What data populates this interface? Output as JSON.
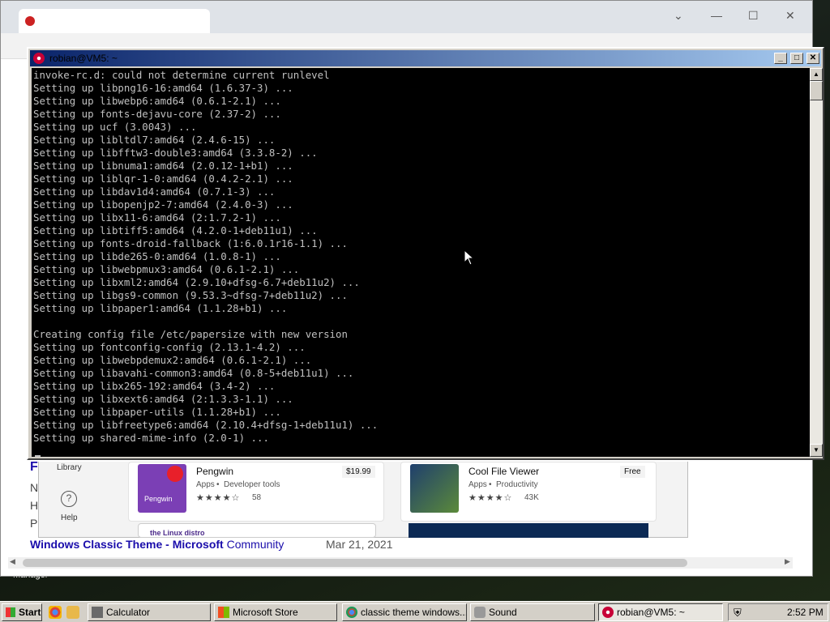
{
  "terminal": {
    "title": "robian@VM5: ~",
    "lines": [
      "invoke-rc.d: could not determine current runlevel",
      "Setting up libpng16-16:amd64 (1.6.37-3) ...",
      "Setting up libwebp6:amd64 (0.6.1-2.1) ...",
      "Setting up fonts-dejavu-core (2.37-2) ...",
      "Setting up ucf (3.0043) ...",
      "Setting up libltdl7:amd64 (2.4.6-15) ...",
      "Setting up libfftw3-double3:amd64 (3.3.8-2) ...",
      "Setting up libnuma1:amd64 (2.0.12-1+b1) ...",
      "Setting up liblqr-1-0:amd64 (0.4.2-2.1) ...",
      "Setting up libdav1d4:amd64 (0.7.1-3) ...",
      "Setting up libopenjp2-7:amd64 (2.4.0-3) ...",
      "Setting up libx11-6:amd64 (2:1.7.2-1) ...",
      "Setting up libtiff5:amd64 (4.2.0-1+deb11u1) ...",
      "Setting up fonts-droid-fallback (1:6.0.1r16-1.1) ...",
      "Setting up libde265-0:amd64 (1.0.8-1) ...",
      "Setting up libwebpmux3:amd64 (0.6.1-2.1) ...",
      "Setting up libxml2:amd64 (2.9.10+dfsg-6.7+deb11u2) ...",
      "Setting up libgs9-common (9.53.3~dfsg-7+deb11u2) ...",
      "Setting up libpaper1:amd64 (1.1.28+b1) ...",
      "",
      "Creating config file /etc/papersize with new version",
      "Setting up fontconfig-config (2.13.1-4.2) ...",
      "Setting up libwebpdemux2:amd64 (0.6.1-2.1) ...",
      "Setting up libavahi-common3:amd64 (0.8-5+deb11u1) ...",
      "Setting up libx265-192:amd64 (3.4-2) ...",
      "Setting up libxext6:amd64 (2:1.3.3-1.1) ...",
      "Setting up libpaper-utils (1.1.28+b1) ...",
      "Setting up libfreetype6:amd64 (2.10.4+dfsg-1+deb11u1) ...",
      "Setting up shared-mime-info (2.0-1) ..."
    ]
  },
  "browser": {
    "result_link_part1": "Windows Classic Theme - ",
    "result_link_part2": "Microsoft",
    "result_link_part3": " Community",
    "result_date": "Mar 21, 2021",
    "edge_letters": [
      "F",
      "N",
      "H",
      "P"
    ],
    "desktop_label": "Manager"
  },
  "store": {
    "library_label": "Library",
    "help_label": "Help",
    "apps": [
      {
        "name": "Pengwin",
        "category": "Apps",
        "subcategory": "Developer tools",
        "price": "$19.99",
        "stars": "★★★★☆",
        "rating_count": "58",
        "banner": "the Linux distro"
      },
      {
        "name": "Cool File Viewer",
        "category": "Apps",
        "subcategory": "Productivity",
        "price": "Free",
        "stars": "★★★★☆",
        "rating_count": "43K"
      }
    ]
  },
  "taskbar": {
    "start_label": "Start",
    "tasks": [
      {
        "label": "Calculator",
        "icon": "calculator-icon"
      },
      {
        "label": "Microsoft Store",
        "icon": "store-icon"
      },
      {
        "label": "classic theme windows...",
        "icon": "chrome-icon"
      },
      {
        "label": "Sound",
        "icon": "speaker-icon"
      },
      {
        "label": "robian@VM5: ~",
        "icon": "debian-icon"
      }
    ],
    "clock": "2:52 PM"
  },
  "colors": {
    "terminal_bg": "#000000",
    "terminal_fg": "#c0c0c0",
    "title_active_start": "#0a246a",
    "title_active_end": "#a6caf0",
    "classic_face": "#d4d0c8",
    "link": "#1a0dab"
  }
}
